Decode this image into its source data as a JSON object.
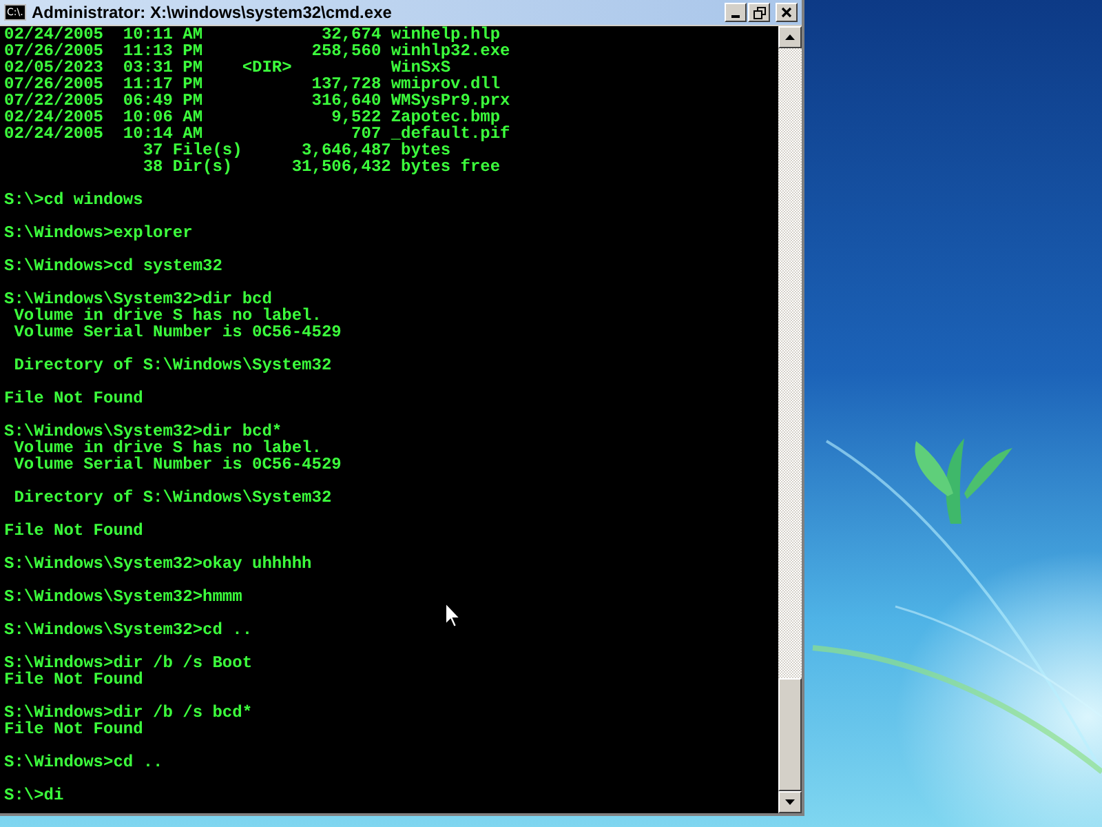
{
  "window": {
    "title": "Administrator: X:\\windows\\system32\\cmd.exe",
    "icon_text": "C:\\."
  },
  "console": {
    "blocks": [
      {
        "lines": [
          "02/24/2005  10:11 AM            32,674 winhelp.hlp",
          "07/26/2005  11:13 PM           258,560 winhlp32.exe",
          "02/05/2023  03:31 PM    <DIR>          WinSxS",
          "07/26/2005  11:17 PM           137,728 wmiprov.dll",
          "07/22/2005  06:49 PM           316,640 WMSysPr9.prx",
          "02/24/2005  10:06 AM             9,522 Zapotec.bmp",
          "02/24/2005  10:14 AM               707 _default.pif",
          "              37 File(s)      3,646,487 bytes",
          "              38 Dir(s)      31,506,432 bytes free"
        ]
      },
      {
        "lines": [
          "S:\\>cd windows"
        ]
      },
      {
        "lines": [
          "S:\\Windows>explorer"
        ]
      },
      {
        "lines": [
          "S:\\Windows>cd system32"
        ]
      },
      {
        "lines": [
          "S:\\Windows\\System32>dir bcd",
          " Volume in drive S has no label.",
          " Volume Serial Number is 0C56-4529"
        ]
      },
      {
        "lines": [
          " Directory of S:\\Windows\\System32"
        ]
      },
      {
        "lines": [
          "File Not Found"
        ]
      },
      {
        "lines": [
          "S:\\Windows\\System32>dir bcd*",
          " Volume in drive S has no label.",
          " Volume Serial Number is 0C56-4529"
        ]
      },
      {
        "lines": [
          " Directory of S:\\Windows\\System32"
        ]
      },
      {
        "lines": [
          "File Not Found"
        ]
      },
      {
        "lines": [
          "S:\\Windows\\System32>okay uhhhhh"
        ]
      },
      {
        "lines": [
          "S:\\Windows\\System32>hmmm"
        ]
      },
      {
        "lines": [
          "S:\\Windows\\System32>cd .."
        ]
      },
      {
        "lines": [
          "S:\\Windows>dir /b /s Boot",
          "File Not Found"
        ]
      },
      {
        "lines": [
          "S:\\Windows>dir /b /s bcd*",
          "File Not Found"
        ]
      },
      {
        "lines": [
          "S:\\Windows>cd .."
        ]
      },
      {
        "lines": [
          "S:\\>di"
        ]
      }
    ]
  }
}
